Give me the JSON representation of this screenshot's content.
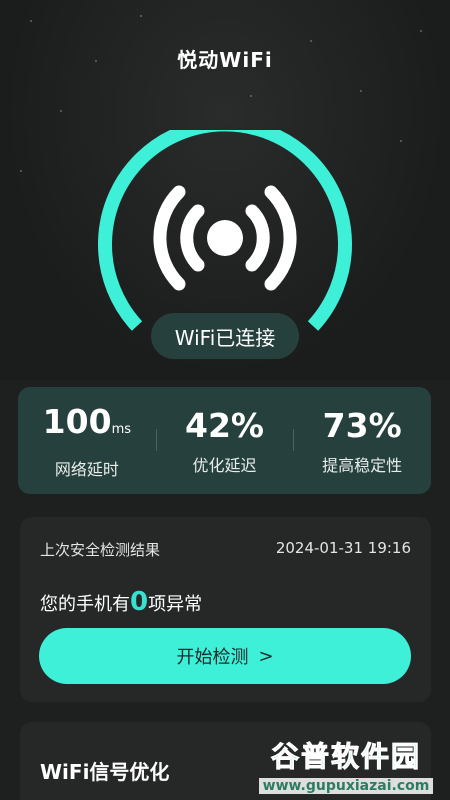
{
  "header": {
    "title": "悦动WiFi"
  },
  "connection": {
    "status": "WiFi已连接"
  },
  "colors": {
    "accent": "#3ef0d8",
    "card": "#26413d",
    "background": "#1e1f1f"
  },
  "stats": [
    {
      "value": "100",
      "unit": "ms",
      "label": "网络延时"
    },
    {
      "value": "42%",
      "unit": "",
      "label": "优化延迟"
    },
    {
      "value": "73%",
      "unit": "",
      "label": "提高稳定性"
    }
  ],
  "scan": {
    "title": "上次安全检测结果",
    "time": "2024-01-31 19:16",
    "result_prefix": "您的手机有",
    "count": "0",
    "result_suffix": "项异常",
    "button_label": "开始检测"
  },
  "optimize": {
    "title": "WiFi信号优化"
  },
  "watermark": {
    "name": "谷普软件园",
    "url": "www.gupuxiazai.com"
  },
  "icons": [
    "wifi-signal-icon",
    "chevron-right-icon"
  ]
}
